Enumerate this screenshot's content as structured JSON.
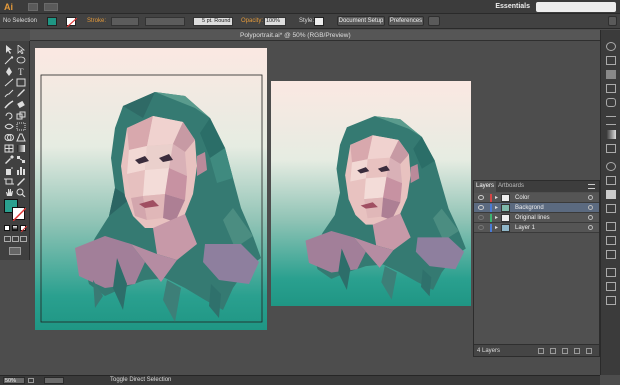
{
  "menubar": {
    "app_logo": "Ai",
    "workspace": "Essentials"
  },
  "control_bar": {
    "selection": "No Selection",
    "stroke_label": "Stroke:",
    "brush": "5 pt. Round",
    "opacity_label": "Opacity:",
    "opacity_value": "100%",
    "style_label": "Style:",
    "document_setup": "Document Setup",
    "preferences": "Preferences"
  },
  "document": {
    "tab_title": "Polyportrait.ai* @ 50% (RGB/Preview)"
  },
  "layers_panel": {
    "tabs": [
      "Layers",
      "Artboards"
    ],
    "layers": [
      {
        "name": "Color",
        "color": "#d64545",
        "selected": false
      },
      {
        "name": "Backgrond",
        "color": "#4a7bd6",
        "selected": true
      },
      {
        "name": "Original lines",
        "color": "#3cb371",
        "selected": false
      },
      {
        "name": "Layer 1",
        "color": "#4a7bd6",
        "selected": false
      }
    ],
    "count": "4 Layers"
  },
  "status_bar": {
    "zoom": "50%",
    "status": "Toggle Direct Selection"
  },
  "colors": {
    "accent_orange": "#e59a3a",
    "artboard_teal": "#1f9684",
    "artboard_pink": "#fbe8e2"
  }
}
